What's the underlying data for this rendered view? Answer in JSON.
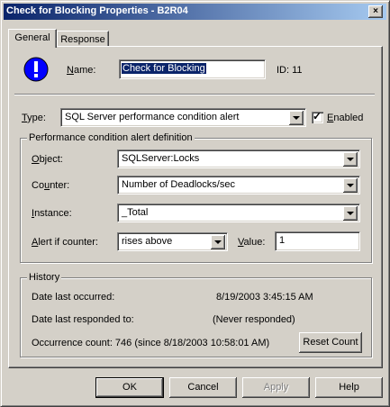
{
  "window": {
    "title": "Check for Blocking Properties - B2R04",
    "close_glyph": "×"
  },
  "tabs": [
    {
      "label": "General",
      "active": true
    },
    {
      "label": "Response",
      "active": false
    }
  ],
  "general": {
    "name_label": "Name:",
    "name_value": "Check for Blocking",
    "id_text": "ID: 11",
    "type_label": "Type:",
    "type_value": "SQL Server performance condition alert",
    "enabled_label": "Enabled",
    "enabled_checked": true,
    "check_glyph": "✓"
  },
  "perf_group": {
    "title": "Performance condition alert definition",
    "object_label": "Object:",
    "object_value": "SQLServer:Locks",
    "counter_label": "Counter:",
    "counter_value": "Number of Deadlocks/sec",
    "instance_label": "Instance:",
    "instance_value": "_Total",
    "alert_label": "Alert if counter:",
    "alert_value": "rises above",
    "value_label": "Value:",
    "value_value": "1"
  },
  "history": {
    "title": "History",
    "last_occurred_label": "Date last occurred:",
    "last_occurred_value": "8/19/2003 3:45:15 AM",
    "last_responded_label": "Date last responded to:",
    "last_responded_value": "(Never responded)",
    "occurrence_text": "Occurrence count:  746 (since 8/18/2003 10:58:01 AM)",
    "reset_label": "Reset Count"
  },
  "buttons": {
    "ok": "OK",
    "cancel": "Cancel",
    "apply": "Apply",
    "help": "Help"
  },
  "colors": {
    "title_start": "#0a246a",
    "title_end": "#a6caf0",
    "face": "#d4d0c8",
    "icon_blue": "#0000ff",
    "selection": "#0a246a"
  },
  "icons": {
    "alert": "info-exclamation-icon"
  }
}
